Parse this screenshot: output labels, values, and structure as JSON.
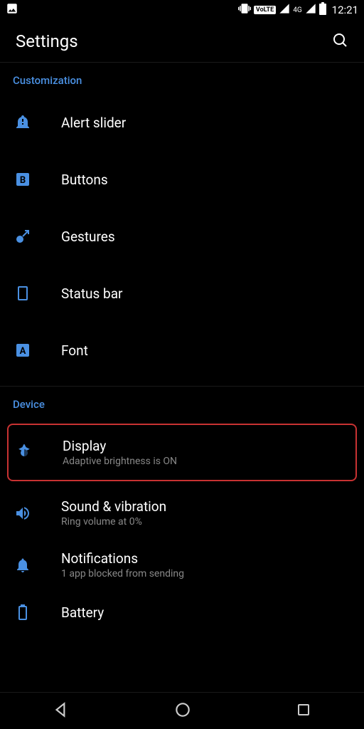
{
  "status_bar": {
    "time": "12:21",
    "volte": "VoLTE",
    "network": "4G"
  },
  "header": {
    "title": "Settings"
  },
  "sections": {
    "customization": {
      "header": "Customization",
      "items": [
        {
          "title": "Alert slider"
        },
        {
          "title": "Buttons"
        },
        {
          "title": "Gestures"
        },
        {
          "title": "Status bar"
        },
        {
          "title": "Font"
        }
      ]
    },
    "device": {
      "header": "Device",
      "items": [
        {
          "title": "Display",
          "subtitle": "Adaptive brightness is ON"
        },
        {
          "title": "Sound & vibration",
          "subtitle": "Ring volume at 0%"
        },
        {
          "title": "Notifications",
          "subtitle": "1 app blocked from sending"
        },
        {
          "title": "Battery"
        }
      ]
    }
  },
  "colors": {
    "accent": "#4a90e2",
    "highlight": "#c83232"
  }
}
